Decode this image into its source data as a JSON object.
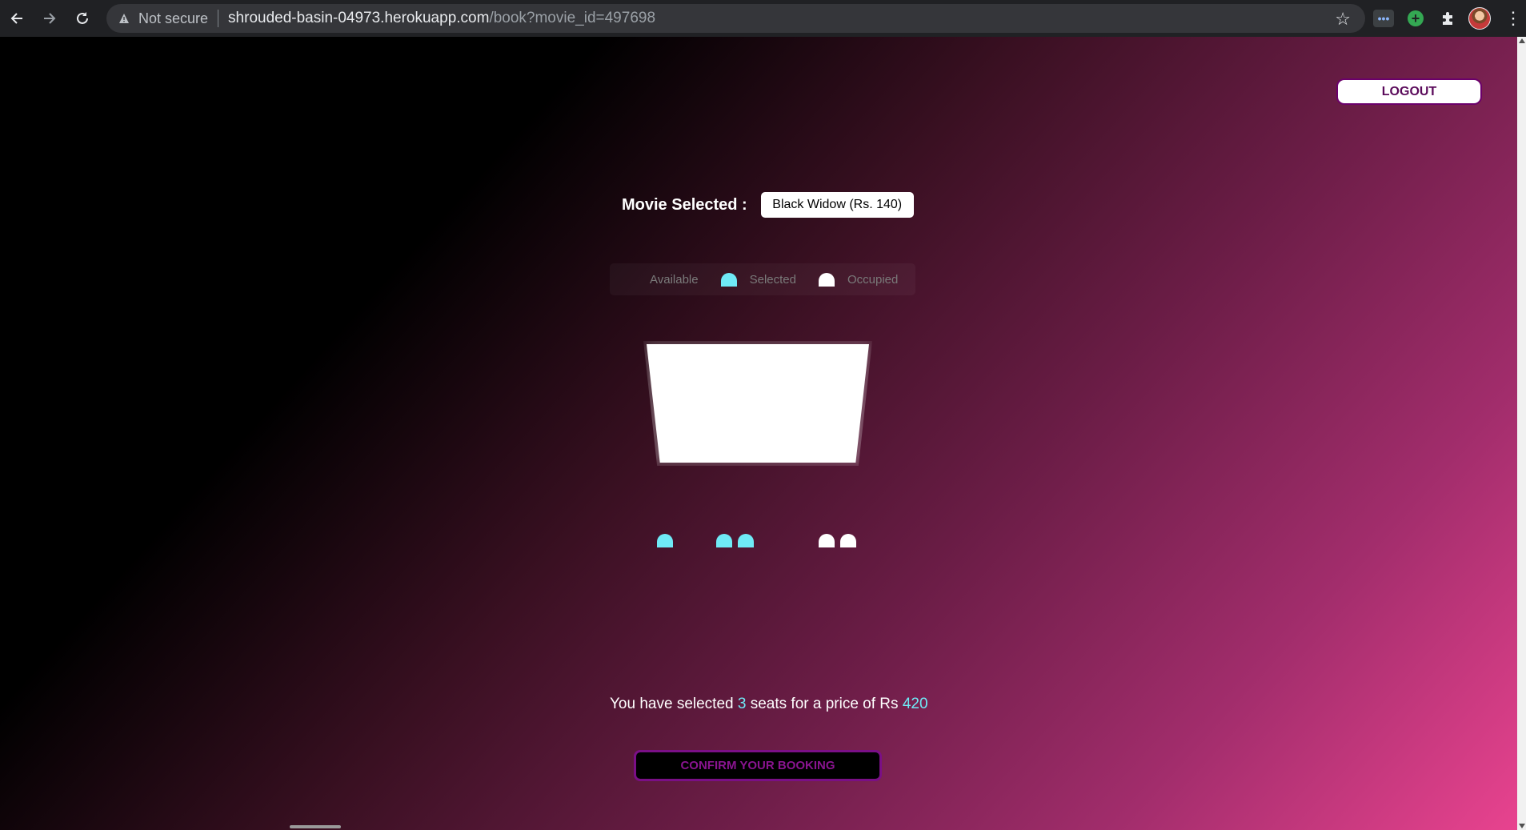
{
  "browser": {
    "security_label": "Not secure",
    "url_host": "shrouded-basin-04973.herokuapp.com",
    "url_path": "/book?movie_id=497698",
    "ext_dots_label": "•••",
    "ext_plus_label": "+"
  },
  "header": {
    "logout_label": "LOGOUT"
  },
  "movie": {
    "label": "Movie Selected :",
    "selected": "Black Widow (Rs. 140)"
  },
  "legend": [
    {
      "label": "Available",
      "state": "available"
    },
    {
      "label": "Selected",
      "state": "selected"
    },
    {
      "label": "Occupied",
      "state": "occupied"
    }
  ],
  "seats": {
    "rows": [
      [
        "selected",
        "available",
        "selected",
        "selected",
        "available",
        "available",
        "occupied",
        "occupied"
      ],
      [
        "available",
        "available",
        "available",
        "available",
        "available",
        "available",
        "available",
        "available"
      ],
      [
        "available",
        "available",
        "available",
        "available",
        "available",
        "available",
        "available",
        "available"
      ],
      [
        "available",
        "available",
        "available",
        "available",
        "available",
        "available",
        "available",
        "available"
      ],
      [
        "available",
        "available",
        "available",
        "available",
        "available",
        "available",
        "available",
        "available"
      ],
      [
        "available",
        "available",
        "available",
        "available",
        "available",
        "available",
        "available",
        "available"
      ]
    ]
  },
  "summary": {
    "prefix": "You have selected ",
    "count": "3",
    "middle": " seats for a price of Rs ",
    "price": "420"
  },
  "confirm_label": "CONFIRM YOUR BOOKING",
  "colors": {
    "available": "#444451",
    "selected": "#6feaf6",
    "occupied": "#ffffff",
    "accent": "#7a0f86"
  }
}
